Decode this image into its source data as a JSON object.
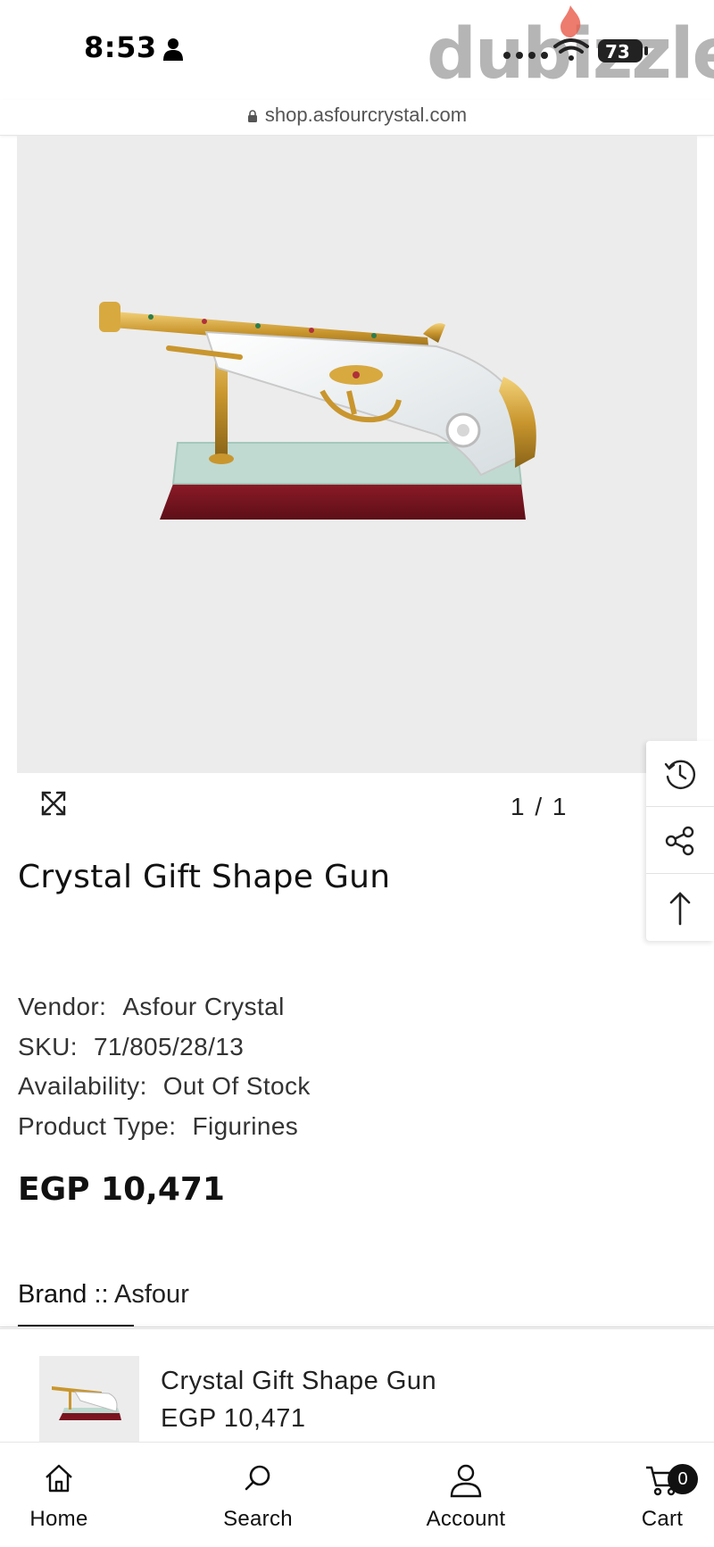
{
  "status_bar": {
    "time": "8:53",
    "battery": "73",
    "watermark": "dubizzle"
  },
  "browser": {
    "url": "shop.asfourcrystal.com"
  },
  "gallery": {
    "counter": "1 / 1"
  },
  "product": {
    "title": "Crystal Gift Shape Gun",
    "vendor_label": "Vendor:",
    "vendor": "Asfour Crystal",
    "sku_label": "SKU:",
    "sku": "71/805/28/13",
    "availability_label": "Availability:",
    "availability": "Out Of Stock",
    "type_label": "Product Type:",
    "type": "Figurines",
    "price": "EGP 10,471"
  },
  "tabs": {
    "brand_label": "Brand ::",
    "brand_value": "Asfour"
  },
  "sticky": {
    "title": "Crystal Gift Shape Gun",
    "price": "EGP 10,471"
  },
  "nav": {
    "home": "Home",
    "search": "Search",
    "account": "Account",
    "cart": "Cart",
    "cart_count": "0"
  }
}
